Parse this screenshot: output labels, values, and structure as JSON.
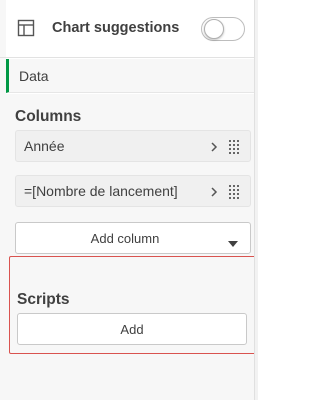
{
  "header": {
    "title": "Chart suggestions",
    "chart_icon": "table-chart-icon",
    "toggle_state": "off"
  },
  "tabs": {
    "data_label": "Data"
  },
  "columns": {
    "heading": "Columns",
    "items": [
      {
        "label": "Année"
      },
      {
        "label": "=[Nombre de lancement]"
      }
    ],
    "add_label": "Add column"
  },
  "scripts": {
    "heading": "Scripts",
    "add_label": "Add"
  },
  "colors": {
    "accent_tab": "#009845",
    "highlight_border": "#d9534f"
  }
}
